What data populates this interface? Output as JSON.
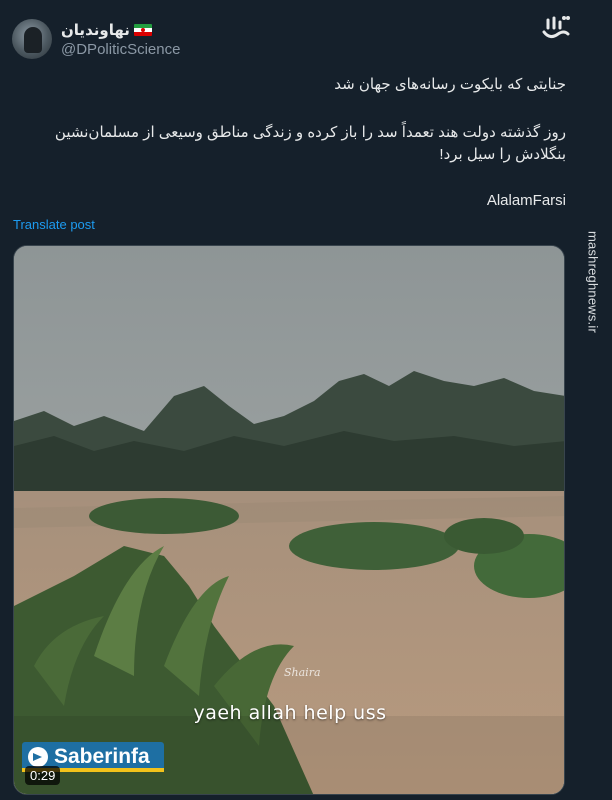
{
  "author": {
    "display_name": "نهاوندیان",
    "flag": "iran-flag-icon",
    "handle": "@DPoliticScience",
    "avatar": "profile-avatar"
  },
  "site_logo": "mashregh-logo",
  "watermark": "mashreghnews.ir",
  "post": {
    "line1": "جنایتی که بایکوت رسانه‌های جهان شد",
    "line2": "روز گذشته دولت هند تعمداً سد را باز کرده و زندگی مناطق وسیعی از مسلمان‌نشین بنگلادش را سیل برد!",
    "line3": "AlalamFarsi",
    "translate_label": "Translate post"
  },
  "media": {
    "caption": "yaeh allah help uss",
    "signature": "Shaira",
    "brand": "Saberinfa",
    "duration": "0:29"
  },
  "colors": {
    "background": "#15202b",
    "link": "#1d9bf0",
    "muted": "#8b98a5",
    "flood_water": "#b39377",
    "brand_badge": "#1e6fa3"
  }
}
